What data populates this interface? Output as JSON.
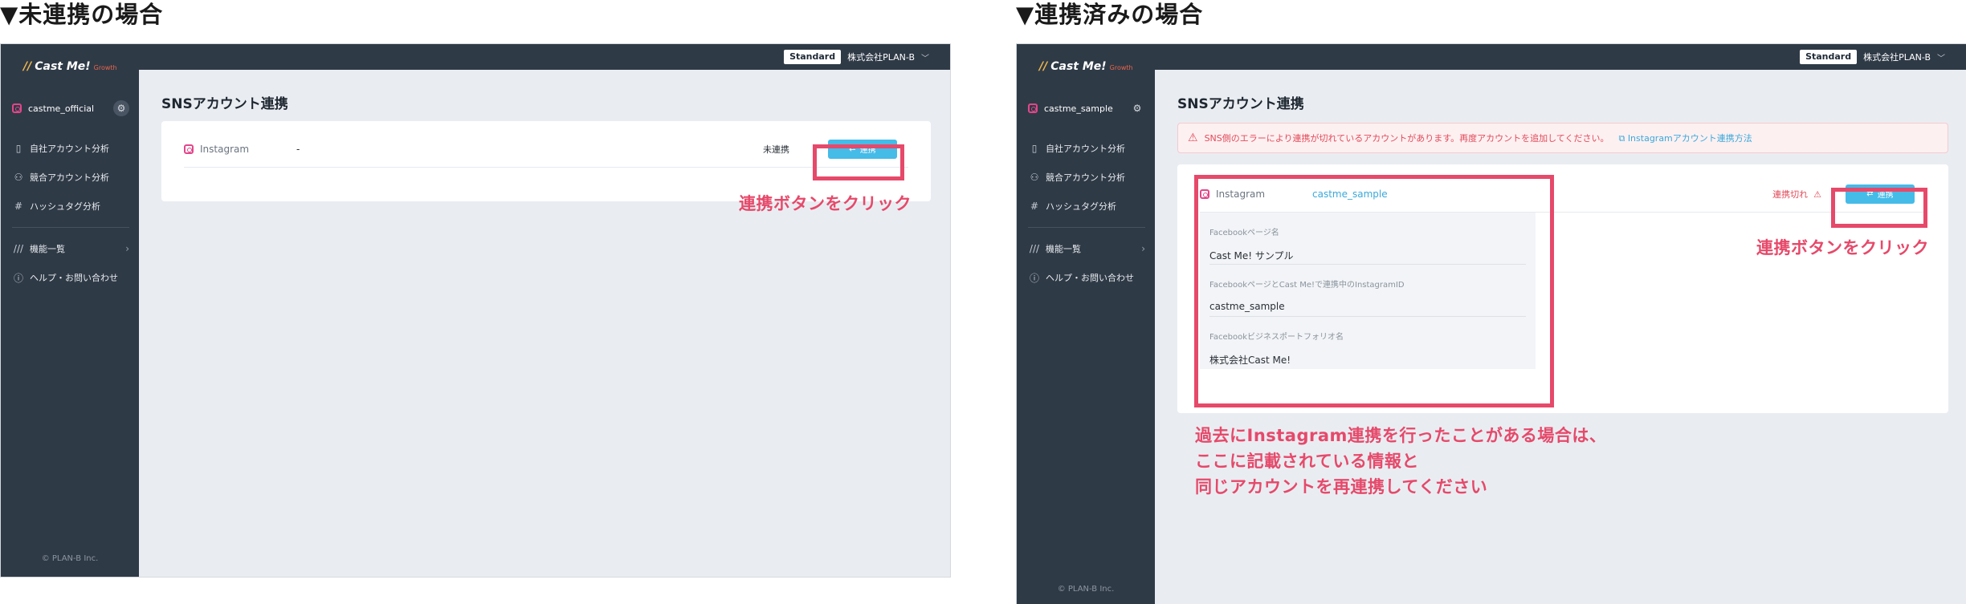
{
  "headings": {
    "left": "▼未連携の場合",
    "right": "▼連携済みの場合"
  },
  "colors": {
    "accent": "#45bbe8",
    "annotation": "#e6496a",
    "sidebar": "#2f3a47",
    "error": "#e24b5a"
  },
  "common": {
    "plan_badge": "Standard",
    "company": "株式会社PLAN-B",
    "logo": {
      "mark": "//",
      "text": "Cast Me!",
      "sub": "Growth"
    },
    "nav": [
      {
        "icon": "building-icon",
        "glyph": "▯",
        "label": "自社アカウント分析"
      },
      {
        "icon": "compare-icon",
        "glyph": "⚇",
        "label": "競合アカウント分析"
      },
      {
        "icon": "hash-icon",
        "glyph": "#",
        "label": "ハッシュタグ分析"
      }
    ],
    "features": {
      "glyph": "///",
      "label": "機能一覧"
    },
    "help": {
      "glyph": "ⓘ",
      "label": "ヘルプ・お問い合わせ"
    },
    "copyright": "© PLAN-B Inc.",
    "page_title": "SNSアカウント連携",
    "service": "Instagram",
    "button_label": "連携"
  },
  "unlinked": {
    "account": "castme_official",
    "handle": "-",
    "status": "未連携",
    "annotation": "連携ボタンをクリック"
  },
  "linked": {
    "account": "castme_sample",
    "alert": "SNS側のエラーにより連携が切れているアカウントがあります。再度アカウントを追加してください。",
    "alert_link": "Instagramアカウント連携方法",
    "handle": "castme_sample",
    "status": "連携切れ",
    "info": [
      {
        "label": "Facebookページ名",
        "value": "Cast Me! サンプル"
      },
      {
        "label": "FacebookページとCast Me!で連携中のInstagramID",
        "value": "castme_sample"
      },
      {
        "label": "Facebookビジネスポートフォリオ名",
        "value": "株式会社Cast Me!"
      }
    ],
    "annotation": "連携ボタンをクリック",
    "note_lines": [
      "過去にInstagram連携を行ったことがある場合は、",
      "ここに記載されている情報と",
      "同じアカウントを再連携してください"
    ]
  }
}
